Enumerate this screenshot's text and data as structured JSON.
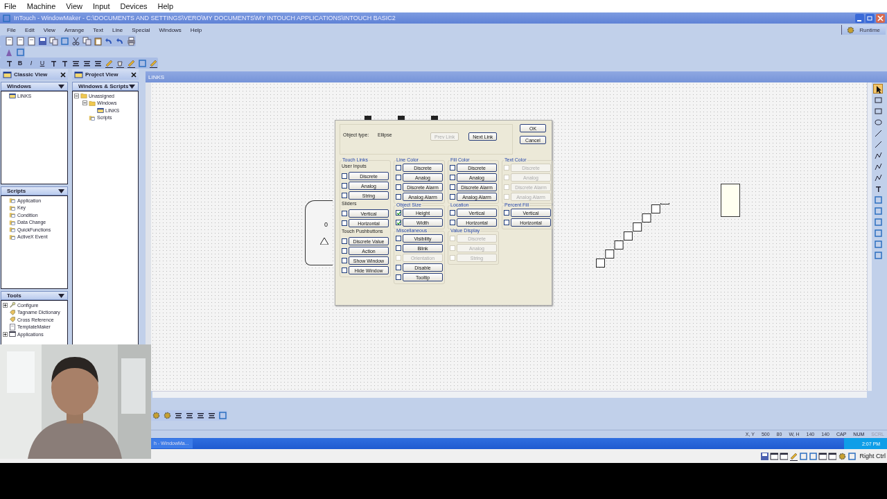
{
  "host_menu": [
    "File",
    "Machine",
    "View",
    "Input",
    "Devices",
    "Help"
  ],
  "window": {
    "title": "InTouch - WindowMaker - C:\\DOCUMENTS AND SETTINGS\\VERO\\MY DOCUMENTS\\MY INTOUCH APPLICATIONS\\INTOUCH BASIC2"
  },
  "menu": [
    "File",
    "Edit",
    "View",
    "Arrange",
    "Text",
    "Line",
    "Special",
    "Windows",
    "Help"
  ],
  "format_buttons": [
    "B",
    "I",
    "U"
  ],
  "runtime_button": "Runtime",
  "classic_view": {
    "title": "Classic View",
    "sections": [
      {
        "title": "Windows",
        "items": [
          {
            "label": "LINKS"
          }
        ]
      },
      {
        "title": "Scripts",
        "items": [
          {
            "label": "Application"
          },
          {
            "label": "Key"
          },
          {
            "label": "Condition"
          },
          {
            "label": "Data Change"
          },
          {
            "label": "QuickFunctions"
          },
          {
            "label": "ActiveX Event"
          }
        ]
      },
      {
        "title": "Tools",
        "items": [
          {
            "label": "Configure",
            "expanded": false
          },
          {
            "label": "Tagname Dictionary"
          },
          {
            "label": "Cross Reference"
          },
          {
            "label": "TemplateMaker"
          },
          {
            "label": "Applications",
            "expanded": false
          }
        ]
      }
    ]
  },
  "project_view": {
    "title": "Project View",
    "dropdown": "Windows & Scripts",
    "tree": [
      {
        "label": "Unassigned",
        "expanded": true,
        "children": [
          {
            "label": "Windows",
            "expanded": true,
            "children": [
              {
                "label": "LINKS"
              }
            ]
          },
          {
            "label": "Scripts"
          }
        ]
      }
    ]
  },
  "canvas": {
    "title": "LINKS",
    "object_text": "0"
  },
  "dialog": {
    "object_type_label": "Object type:",
    "object_type": "Ellipse",
    "nav_buttons": [
      {
        "label": "Prev Link",
        "disabled": true
      },
      {
        "label": "Next Link",
        "disabled": false
      }
    ],
    "ok": "OK",
    "cancel": "Cancel",
    "columns": [
      [
        {
          "title": "Touch Links",
          "disabled": false,
          "items": [
            {
              "kind": "heading",
              "label": "User Inputs"
            },
            {
              "kind": "link",
              "label": "Discrete",
              "checked": false,
              "disabled": false
            },
            {
              "kind": "link",
              "label": "Analog",
              "checked": false,
              "disabled": false
            },
            {
              "kind": "link",
              "label": "String",
              "checked": false,
              "disabled": false
            },
            {
              "kind": "heading",
              "label": "Sliders"
            },
            {
              "kind": "link",
              "label": "Vertical",
              "checked": false,
              "disabled": false
            },
            {
              "kind": "link",
              "label": "Horizontal",
              "checked": false,
              "disabled": false
            },
            {
              "kind": "heading",
              "label": "Touch Pushbuttons"
            },
            {
              "kind": "link",
              "label": "Discrete Value",
              "checked": false,
              "disabled": false
            },
            {
              "kind": "link",
              "label": "Action",
              "checked": false,
              "disabled": false
            },
            {
              "kind": "link",
              "label": "Show Window",
              "checked": false,
              "disabled": false
            },
            {
              "kind": "link",
              "label": "Hide Window",
              "checked": false,
              "disabled": false
            }
          ]
        }
      ],
      [
        {
          "title": "Line Color",
          "disabled": false,
          "items": [
            {
              "kind": "link",
              "label": "Discrete",
              "checked": false,
              "disabled": false
            },
            {
              "kind": "link",
              "label": "Analog",
              "checked": false,
              "disabled": false
            },
            {
              "kind": "link",
              "label": "Discrete Alarm",
              "checked": false,
              "disabled": false
            },
            {
              "kind": "link",
              "label": "Analog Alarm",
              "checked": false,
              "disabled": false
            }
          ]
        },
        {
          "title": "Object Size",
          "disabled": false,
          "items": [
            {
              "kind": "link",
              "label": "Height",
              "checked": true,
              "disabled": false
            },
            {
              "kind": "link",
              "label": "Width",
              "checked": true,
              "disabled": false
            }
          ]
        },
        {
          "title": "Miscellaneous",
          "disabled": false,
          "items": [
            {
              "kind": "link",
              "label": "Visibility",
              "checked": false,
              "disabled": false
            },
            {
              "kind": "link",
              "label": "Blink",
              "checked": false,
              "disabled": false
            },
            {
              "kind": "link",
              "label": "Orientation",
              "checked": false,
              "disabled": true
            },
            {
              "kind": "link",
              "label": "Disable",
              "checked": false,
              "disabled": false
            },
            {
              "kind": "link",
              "label": "Tooltip",
              "checked": false,
              "disabled": false
            }
          ]
        }
      ],
      [
        {
          "title": "Fill Color",
          "disabled": false,
          "items": [
            {
              "kind": "link",
              "label": "Discrete",
              "checked": false,
              "disabled": false
            },
            {
              "kind": "link",
              "label": "Analog",
              "checked": false,
              "disabled": false
            },
            {
              "kind": "link",
              "label": "Discrete Alarm",
              "checked": false,
              "disabled": false
            },
            {
              "kind": "link",
              "label": "Analog Alarm",
              "checked": false,
              "disabled": false
            }
          ]
        },
        {
          "title": "Location",
          "disabled": false,
          "items": [
            {
              "kind": "link",
              "label": "Vertical",
              "checked": false,
              "disabled": false
            },
            {
              "kind": "link",
              "label": "Horizontal",
              "checked": false,
              "disabled": false
            }
          ]
        },
        {
          "title": "Value Display",
          "disabled": false,
          "items": [
            {
              "kind": "link",
              "label": "Discrete",
              "checked": false,
              "disabled": true
            },
            {
              "kind": "link",
              "label": "Analog",
              "checked": false,
              "disabled": true
            },
            {
              "kind": "link",
              "label": "String",
              "checked": false,
              "disabled": true
            }
          ]
        }
      ],
      [
        {
          "title": "Text Color",
          "disabled": false,
          "items": [
            {
              "kind": "link",
              "label": "Discrete",
              "checked": false,
              "disabled": true
            },
            {
              "kind": "link",
              "label": "Analog",
              "checked": false,
              "disabled": true
            },
            {
              "kind": "link",
              "label": "Discrete Alarm",
              "checked": false,
              "disabled": true
            },
            {
              "kind": "link",
              "label": "Analog Alarm",
              "checked": false,
              "disabled": true
            }
          ]
        },
        {
          "title": "Percent Fill",
          "disabled": false,
          "items": [
            {
              "kind": "link",
              "label": "Vertical",
              "checked": false,
              "disabled": false
            },
            {
              "kind": "link",
              "label": "Horizontal",
              "checked": false,
              "disabled": false
            }
          ]
        }
      ]
    ]
  },
  "status_bar": {
    "fields": [
      "X, Y",
      "500",
      "80",
      "W, H",
      "140",
      "140"
    ],
    "indicators": [
      {
        "label": "CAP",
        "on": true
      },
      {
        "label": "NUM",
        "on": true
      },
      {
        "label": "SCRL",
        "on": false
      }
    ]
  },
  "taskbar": {
    "task": "h - WindowMa...",
    "clock": "2:07 PM"
  },
  "host_status": {
    "label": "Right Ctrl"
  }
}
